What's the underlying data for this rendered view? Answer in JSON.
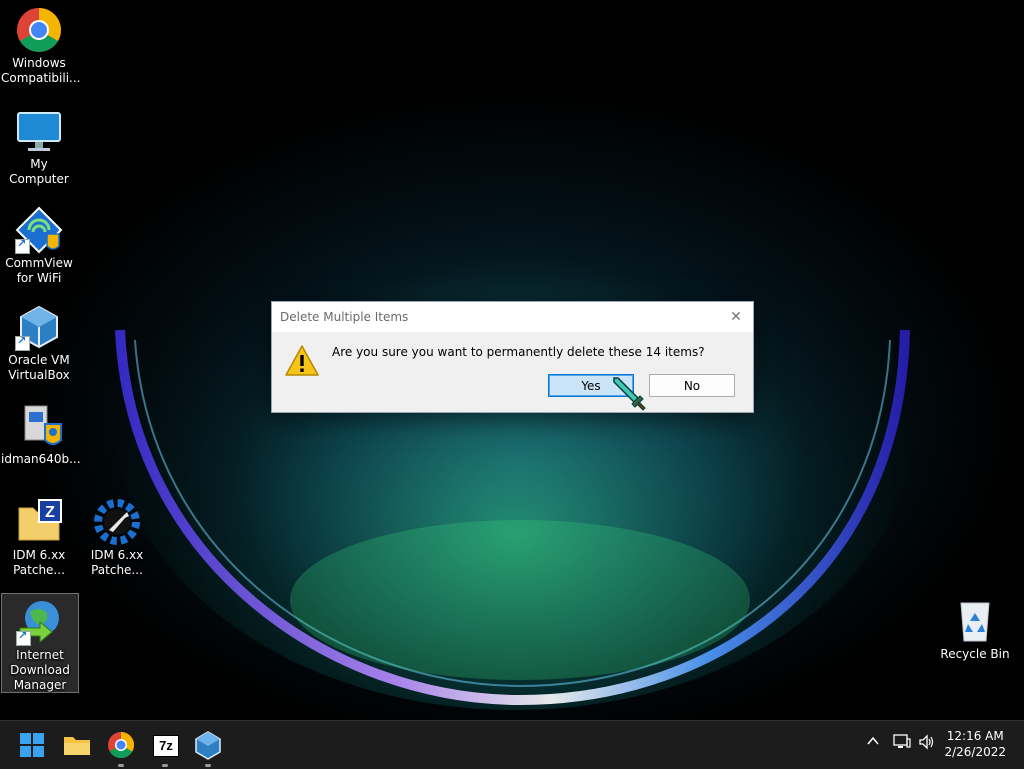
{
  "desktop": {
    "icons": [
      {
        "label": "Windows Compatibili..."
      },
      {
        "label": "My Computer"
      },
      {
        "label": "CommView for WiFi"
      },
      {
        "label": "Oracle VM VirtualBox"
      },
      {
        "label": "idman640b..."
      },
      {
        "label": "IDM 6.xx Patche..."
      },
      {
        "label": "IDM 6.xx Patche..."
      },
      {
        "label": "Internet Download Manager"
      },
      {
        "label": "Recycle Bin"
      }
    ]
  },
  "dialog": {
    "title": "Delete Multiple Items",
    "message": "Are you sure you want to permanently delete these 14 items?",
    "yes_label": "Yes",
    "no_label": "No",
    "close_icon": "close-icon",
    "warning_icon": "warning-icon"
  },
  "taskbar": {
    "apps": [
      "start-icon",
      "file-explorer-icon",
      "chrome-icon",
      "7zip-icon",
      "virtualbox-icon"
    ],
    "app_7z_text": "7z",
    "clock_time": "12:16 AM",
    "clock_date": "2/26/2022"
  },
  "colors": {
    "accent": "#0078d7",
    "taskbar_bg": "#1c1c1c",
    "dialog_bg": "#f0f0f0",
    "warning": "#f5c518"
  }
}
